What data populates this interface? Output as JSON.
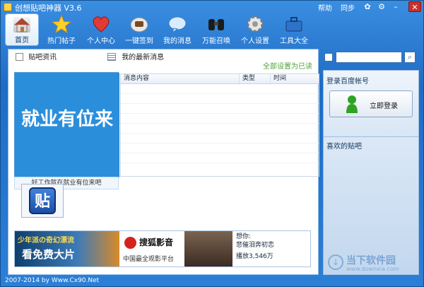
{
  "titlebar": {
    "app_title": "创想贴吧神器 V3.6",
    "help": "帮助",
    "sync": "同步"
  },
  "toolbar": {
    "items": [
      {
        "label": "首页",
        "icon": "home-icon"
      },
      {
        "label": "热门帖子",
        "icon": "star-icon"
      },
      {
        "label": "个人中心",
        "icon": "heart-icon"
      },
      {
        "label": "一键签到",
        "icon": "sign-icon"
      },
      {
        "label": "我的消息",
        "icon": "message-icon"
      },
      {
        "label": "万能召唤",
        "icon": "binoculars-icon"
      },
      {
        "label": "个人设置",
        "icon": "gear-icon"
      },
      {
        "label": "工具大全",
        "icon": "toolbox-icon"
      }
    ]
  },
  "left": {
    "news_title": "贴吧资讯",
    "news_caption": "好工作就在就业有位来吧",
    "news_art": "就业有位来",
    "tieba_badge": "贴"
  },
  "messages": {
    "title": "我的最新消息",
    "mark_read": "全部设置为已读",
    "columns": [
      "消息内容",
      "类型",
      "时间"
    ]
  },
  "ad": {
    "banner1": "少年派の奇幻漂流",
    "banner1_sub": "看免费大片",
    "brand": "搜狐影音",
    "brand_sub": "中国最全观影平台",
    "side_text_1": "想你:",
    "side_text_2": "悲催泪奔初恋",
    "plays": "播放3,546万"
  },
  "login": {
    "title": "登录百度帐号",
    "button": "立即登录",
    "fav_title": "喜欢的贴吧"
  },
  "footer": {
    "text": "2007-2014 by Www.Cx90.Net"
  },
  "watermark": {
    "brand": "当下软件园",
    "url": "www.downxia.com"
  }
}
